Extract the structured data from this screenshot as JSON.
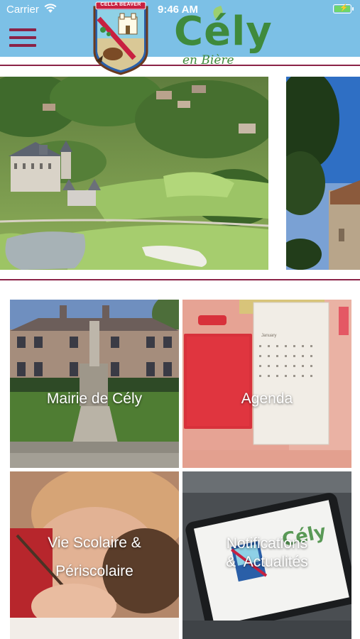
{
  "status_bar": {
    "carrier": "Carrier",
    "time": "9:46 AM"
  },
  "header": {
    "crest_banner": "CELLA BEAVER",
    "title": "Cély",
    "subtitle": "en Bière",
    "title_color": "#3f8a3c",
    "accent_color": "#8b2347",
    "background": "#7cc0e6"
  },
  "carousel": {
    "slides": [
      {
        "name": "aerial-chateau-golf-photo"
      },
      {
        "name": "church-tree-photo"
      }
    ]
  },
  "tiles": [
    {
      "id": "mairie",
      "lines": [
        "Mairie de Cély"
      ]
    },
    {
      "id": "agenda",
      "lines": [
        "Agenda"
      ],
      "calendar_month": "January"
    },
    {
      "id": "vie-scolaire",
      "lines": [
        "Vie Scolaire &",
        "Périscolaire"
      ]
    },
    {
      "id": "notifications",
      "lines": [
        "Notifications",
        "&  Actualités"
      ],
      "tablet_text": "Cély"
    }
  ],
  "icons": {
    "menu": "hamburger-menu-icon",
    "wifi": "wifi-icon",
    "battery": "battery-charging-icon"
  }
}
